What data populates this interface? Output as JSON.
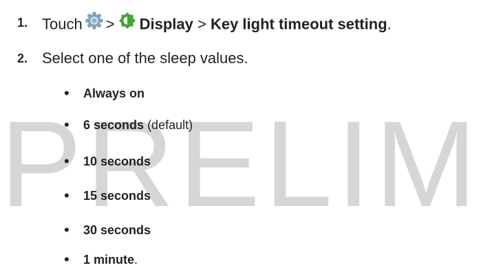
{
  "watermark": "PRELIM",
  "steps": [
    {
      "number": "1.",
      "prefix": "Touch",
      "icon1": "gear-settings-icon",
      "sep1": ">",
      "icon2": "display-brightness-icon",
      "display_label": "Display",
      "sep2": ">",
      "setting_label": "Key light timeout setting",
      "suffix": "."
    },
    {
      "number": "2.",
      "text": "Select one of the sleep values."
    }
  ],
  "options": [
    {
      "label": "Always on",
      "note": ""
    },
    {
      "label": "6 seconds",
      "note": "(default)"
    },
    {
      "label": "10 seconds",
      "note": ""
    },
    {
      "label": "15 seconds",
      "note": ""
    },
    {
      "label": "30 seconds",
      "note": ""
    },
    {
      "label": "1 minute",
      "note": "",
      "suffix": "."
    }
  ],
  "colors": {
    "gear_icon": "#7ea3b8",
    "display_icon": "#3fa535",
    "watermark": "#d6d6d6",
    "text": "#222222"
  }
}
